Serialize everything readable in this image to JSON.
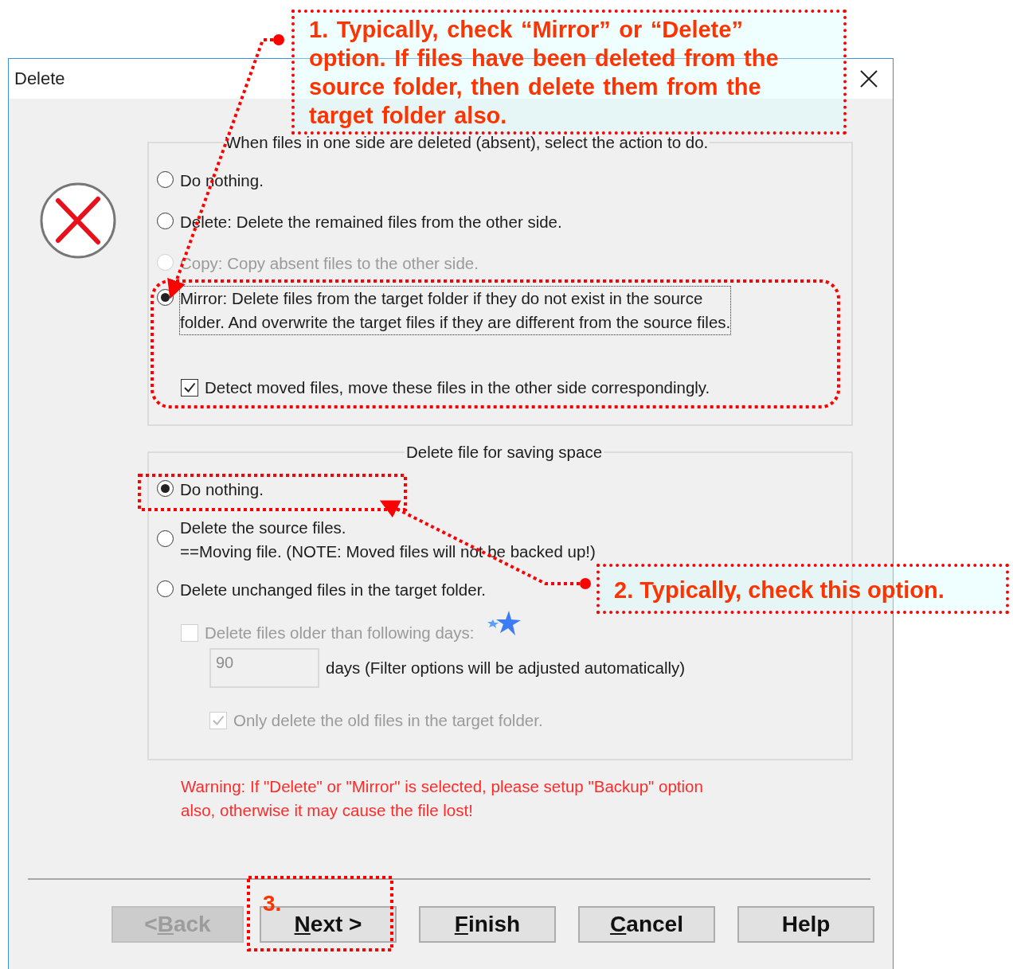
{
  "window": {
    "title": "Delete"
  },
  "deleted_group": {
    "title": "When files in one side are deleted (absent), select the action to do.",
    "options": [
      {
        "label": "Do nothing.",
        "selected": false,
        "disabled": false,
        "focused": false
      },
      {
        "label": "Delete: Delete the remained files from the other side.",
        "selected": false,
        "disabled": false,
        "focused": false
      },
      {
        "label": "Copy: Copy absent files to the other side.",
        "selected": false,
        "disabled": true,
        "focused": false
      },
      {
        "label": "Mirror: Delete files from the target folder if they do not exist in the source\nfolder. And overwrite the target files if they are different from the source files.",
        "selected": true,
        "disabled": false,
        "focused": true
      }
    ],
    "detect_moved": {
      "label": "Detect moved files, move these files in the other side correspondingly.",
      "checked": true,
      "disabled": false
    }
  },
  "space_group": {
    "title": "Delete file for saving space",
    "options": [
      {
        "label": "Do nothing.",
        "selected": true,
        "disabled": false
      },
      {
        "label": "Delete the source files.\n==Moving file. (NOTE: Moved files will not be backed up!)",
        "selected": false,
        "disabled": false
      },
      {
        "label": "Delete unchanged files in the target folder.",
        "selected": false,
        "disabled": false
      }
    ],
    "older_days": {
      "label": "Delete files older than following days:",
      "checked": false,
      "disabled": true
    },
    "days_field": {
      "value": "90",
      "disabled": true
    },
    "days_note": "days (Filter options will be adjusted automatically)",
    "only_target": {
      "label": "Only delete the old files in the target folder.",
      "checked": true,
      "disabled": true
    }
  },
  "warning": "Warning: If \"Delete\" or \"Mirror\" is selected, please setup \"Backup\" option\nalso, otherwise it may cause the file lost!",
  "buttons": [
    {
      "before": "<",
      "key": "B",
      "after": "ack",
      "disabled": true
    },
    {
      "key": "N",
      "after": "ext >",
      "disabled": false
    },
    {
      "key": "F",
      "after": "inish",
      "disabled": false
    },
    {
      "key": "C",
      "after": "ancel",
      "disabled": false
    },
    {
      "before": "Help",
      "disabled": false
    }
  ],
  "annotations": {
    "callouts": [
      "1. Typically, check “Mirror” or “Delete” option. If files have been deleted from the source folder, then delete them from the target folder also.",
      "2. Typically, check this option."
    ],
    "step_label": "3."
  }
}
